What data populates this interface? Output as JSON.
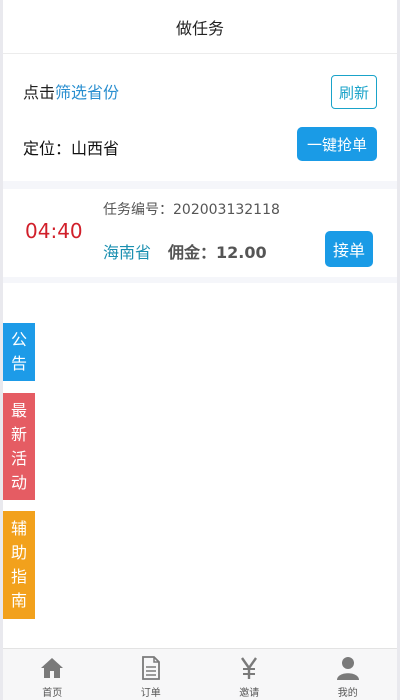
{
  "header": {
    "title": "做任务"
  },
  "filter": {
    "prefix": "点击",
    "link_label": "筛选省份",
    "refresh_label": "刷新"
  },
  "location": {
    "label": "定位：山西省",
    "grab_label": "一键抢单"
  },
  "task": {
    "countdown": "04:40",
    "task_no": "任务编号：202003132118",
    "province": "海南省",
    "commission": "佣金：12.00",
    "accept_label": "接单"
  },
  "side_tabs": {
    "notice": [
      "公",
      "告"
    ],
    "activity": [
      "最",
      "新",
      "活",
      "动"
    ],
    "guide": [
      "辅",
      "助",
      "指",
      "南"
    ]
  },
  "colors": {
    "primary": "#1a9be6",
    "notice": "#1d9be8",
    "activity": "#e55c63",
    "guide": "#f2a11c",
    "countdown": "#d11f2a"
  },
  "bottom_nav": [
    {
      "label": "首页",
      "icon": "home-icon"
    },
    {
      "label": "订单",
      "icon": "document-icon"
    },
    {
      "label": "邀请",
      "icon": "yen-icon"
    },
    {
      "label": "我的",
      "icon": "user-icon"
    }
  ]
}
